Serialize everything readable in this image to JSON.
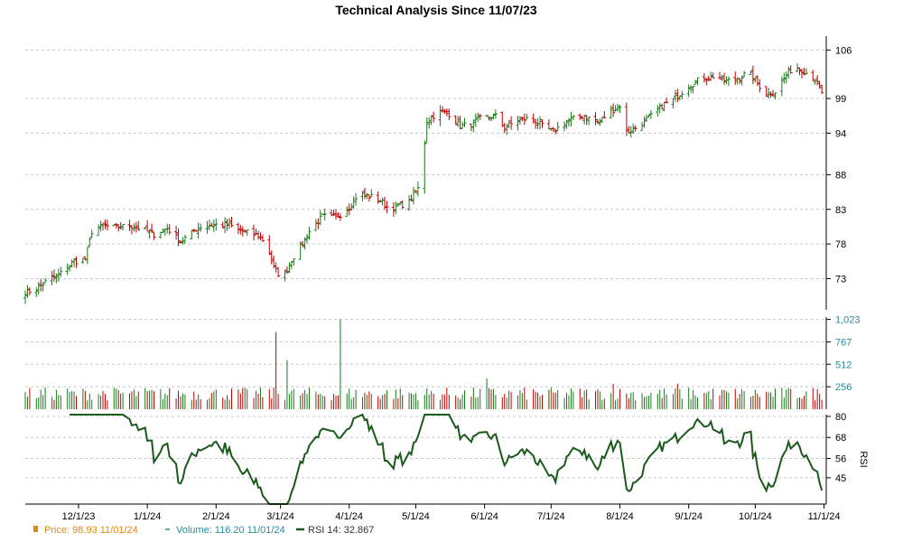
{
  "title": "Technical Analysis Since 11/07/23",
  "colors": {
    "up": "#1a7a1a",
    "down": "#c00000",
    "price_legend": "#e08a10",
    "volume": "#2a8c9a",
    "rsi": "#1a5a1a",
    "grid": "#c8c8c8"
  },
  "legend": {
    "price": "Price: 98.93  11/01/24",
    "volume": "Volume: 116.20  11/01/24",
    "rsi": "RSI 14: 32.867"
  },
  "chart_data": [
    {
      "type": "bar",
      "name": "price",
      "y_ticks": [
        "106",
        "99",
        "94",
        "88",
        "83",
        "78",
        "73"
      ],
      "y_tick_values": [
        106,
        99,
        94,
        88,
        83,
        78,
        73
      ],
      "ylim": [
        68.5,
        108
      ],
      "x_ticks": [
        "12/1/23",
        "1/1/24",
        "2/1/24",
        "3/1/24",
        "4/1/24",
        "5/1/24",
        "6/1/24",
        "7/1/24",
        "8/1/24",
        "9/1/24",
        "10/1/24",
        "11/1/24"
      ],
      "x_tick_days": [
        24,
        55,
        86,
        115,
        146,
        176,
        207,
        237,
        268,
        299,
        329,
        360
      ],
      "x_range": [
        0,
        361
      ],
      "anchors": [
        [
          0,
          71
        ],
        [
          5,
          71.5
        ],
        [
          10,
          72.8
        ],
        [
          15,
          73.5
        ],
        [
          22,
          75.5
        ],
        [
          27,
          75.8
        ],
        [
          30,
          79.8
        ],
        [
          35,
          80.6
        ],
        [
          40,
          80.4
        ],
        [
          47,
          80.6
        ],
        [
          52,
          80.2
        ],
        [
          58,
          79.4
        ],
        [
          64,
          80.3
        ],
        [
          70,
          78.3
        ],
        [
          78,
          80.4
        ],
        [
          85,
          80.8
        ],
        [
          92,
          80.7
        ],
        [
          98,
          79.8
        ],
        [
          105,
          79.2
        ],
        [
          109,
          78.0
        ],
        [
          112,
          74.5
        ],
        [
          116,
          73.0
        ],
        [
          120,
          75.8
        ],
        [
          124,
          77.5
        ],
        [
          128,
          79.8
        ],
        [
          134,
          82.0
        ],
        [
          140,
          81.8
        ],
        [
          146,
          83.3
        ],
        [
          150,
          85.3
        ],
        [
          156,
          84.8
        ],
        [
          160,
          84.3
        ],
        [
          164,
          83.0
        ],
        [
          168,
          83.5
        ],
        [
          173,
          84.0
        ],
        [
          178,
          86.5
        ],
        [
          181,
          95.8
        ],
        [
          186,
          97.0
        ],
        [
          191,
          96.8
        ],
        [
          196,
          95.0
        ],
        [
          201,
          95.3
        ],
        [
          206,
          96.3
        ],
        [
          212,
          96.4
        ],
        [
          216,
          94.8
        ],
        [
          222,
          95.8
        ],
        [
          228,
          96.2
        ],
        [
          233,
          95.0
        ],
        [
          238,
          94.2
        ],
        [
          244,
          95.8
        ],
        [
          252,
          96.5
        ],
        [
          258,
          95.5
        ],
        [
          264,
          97.2
        ],
        [
          268,
          98.0
        ],
        [
          270,
          94.0
        ],
        [
          274,
          94.5
        ],
        [
          278,
          95.5
        ],
        [
          283,
          96.7
        ],
        [
          288,
          98.2
        ],
        [
          292,
          98.8
        ],
        [
          298,
          100.6
        ],
        [
          304,
          101.8
        ],
        [
          310,
          102.2
        ],
        [
          316,
          101.5
        ],
        [
          322,
          102.0
        ],
        [
          326,
          102.8
        ],
        [
          330,
          101.2
        ],
        [
          334,
          99.6
        ],
        [
          338,
          100.0
        ],
        [
          342,
          101.9
        ],
        [
          345,
          103.1
        ],
        [
          348,
          103.5
        ],
        [
          352,
          102.7
        ],
        [
          356,
          101.8
        ],
        [
          360,
          98.9
        ]
      ],
      "volume_axis": {
        "y_ticks": [
          "1,023",
          "767",
          "512",
          "256"
        ],
        "y_tick_values": [
          1023,
          767,
          512,
          256
        ],
        "ylim": [
          0,
          1050
        ]
      },
      "rsi_axis": {
        "label": "RSI",
        "y_ticks": [
          "80",
          "68",
          "56",
          "45"
        ],
        "y_tick_values": [
          80,
          68,
          56,
          45
        ],
        "ylim": [
          30,
          81
        ]
      }
    }
  ]
}
